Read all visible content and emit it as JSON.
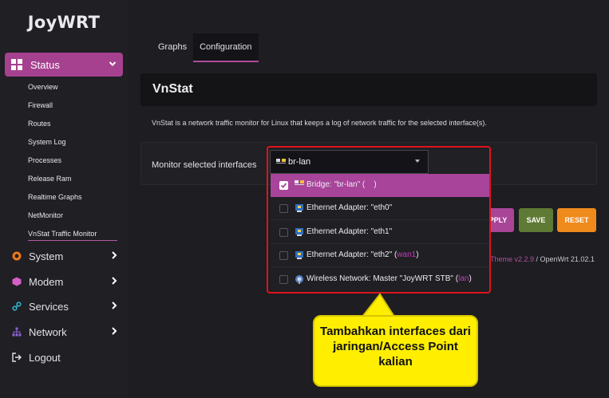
{
  "brand": {
    "logo": "JoyWRT"
  },
  "sidebar": {
    "status": {
      "label": "Status"
    },
    "subitems": [
      {
        "label": "Overview"
      },
      {
        "label": "Firewall"
      },
      {
        "label": "Routes"
      },
      {
        "label": "System Log"
      },
      {
        "label": "Processes"
      },
      {
        "label": "Release Ram"
      },
      {
        "label": "Realtime Graphs"
      },
      {
        "label": "NetMonitor"
      },
      {
        "label": "VnStat Traffic Monitor"
      }
    ],
    "items": [
      {
        "label": "System",
        "icon": "gear-icon"
      },
      {
        "label": "Modem",
        "icon": "cube-icon"
      },
      {
        "label": "Services",
        "icon": "link-icon"
      },
      {
        "label": "Network",
        "icon": "network-icon"
      },
      {
        "label": "Logout",
        "icon": "logout-icon"
      }
    ]
  },
  "tabs": [
    {
      "label": "Graphs"
    },
    {
      "label": "Configuration"
    }
  ],
  "page": {
    "title": "VnStat",
    "description": "VnStat is a network traffic monitor for Linux that keeps a log of network traffic for the selected interface(s)."
  },
  "form": {
    "label": "Monitor selected interfaces",
    "selected_value": "br-lan",
    "options": [
      {
        "text": "Bridge: \"br-lan\" (",
        "zone": "",
        "after": "    )",
        "checked": true,
        "icon": "bridge-icon"
      },
      {
        "text": "Ethernet Adapter: \"eth0\"",
        "zone": "",
        "after": "",
        "checked": false,
        "icon": "ethernet-icon"
      },
      {
        "text": "Ethernet Adapter: \"eth1\"",
        "zone": "",
        "after": "",
        "checked": false,
        "icon": "ethernet-icon"
      },
      {
        "text": "Ethernet Adapter: \"eth2\" (",
        "zone": "wan1",
        "after": ")",
        "checked": false,
        "icon": "ethernet-icon"
      },
      {
        "text": "Wireless Network: Master \"JoyWRT STB\" (",
        "zone": "lan",
        "after": ")",
        "checked": false,
        "icon": "wireless-icon"
      }
    ]
  },
  "buttons": {
    "apply": "PPLY",
    "save": "SAVE",
    "reset": "RESET"
  },
  "footer": {
    "theme": "Theme v2.2.9",
    "rest": " / OpenWrt 21.02.1"
  },
  "callout": {
    "text": "Tambahkan interfaces dari jaringan/Access Point kalian"
  },
  "colors": {
    "accent": "#a6418f",
    "save": "#5f7a34",
    "reset": "#ef8a1c",
    "highlight": "#e0141b",
    "callout": "#ffee00"
  }
}
